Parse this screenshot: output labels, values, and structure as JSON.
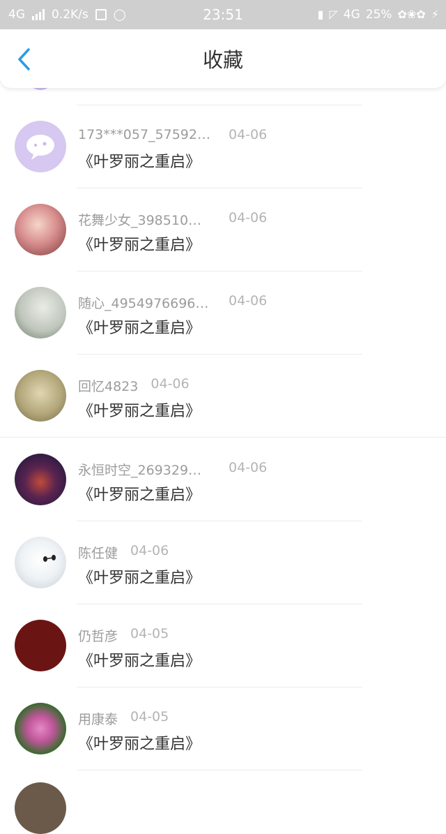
{
  "status_bar": {
    "network_left": "4G",
    "speed": "0.2K/s",
    "time": "23:51",
    "network_right": "4G",
    "battery": "25%"
  },
  "header": {
    "title": "收藏"
  },
  "items": [
    {
      "name": "173***057_57592…",
      "date": "04-06",
      "book": "《叶罗丽之重启》",
      "avatar_color": "#d6c8f0"
    },
    {
      "name": "花舞少女_398510…",
      "date": "04-06",
      "book": "《叶罗丽之重启》",
      "avatar_color": "#e7b9b9"
    },
    {
      "name": "随心_4954976696…",
      "date": "04-06",
      "book": "《叶罗丽之重启》",
      "avatar_color": "#c9d1c7"
    },
    {
      "name": "回忆4823",
      "date": "04-06",
      "book": "《叶罗丽之重启》",
      "avatar_color": "#b9ad83"
    },
    {
      "name": "永恒时空_269329…",
      "date": "04-06",
      "book": "《叶罗丽之重启》",
      "avatar_color": "#2a2a5a"
    },
    {
      "name": "陈任健",
      "date": "04-06",
      "book": "《叶罗丽之重启》",
      "avatar_color": "#e6ecf2"
    },
    {
      "name": "仍哲彦",
      "date": "04-05",
      "book": "《叶罗丽之重启》",
      "avatar_color": "#6b1414"
    },
    {
      "name": "用康泰",
      "date": "04-05",
      "book": "《叶罗丽之重启》",
      "avatar_color": "#3a6b2e"
    }
  ],
  "icons": {
    "back": "chevron-left-icon"
  },
  "colors": {
    "accent": "#2c9be6",
    "status_bar_bg": "#cfcfcf"
  }
}
